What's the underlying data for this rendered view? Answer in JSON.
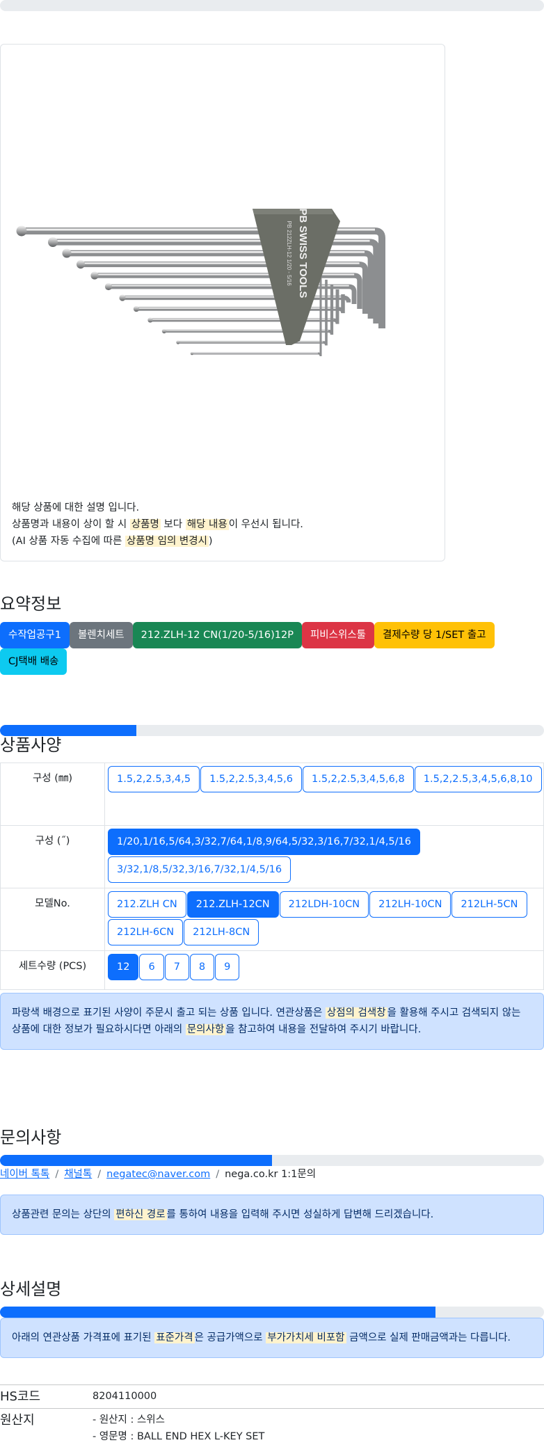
{
  "product": {
    "description_lines": [
      {
        "parts": [
          {
            "t": "해당 상품에 대한 설명 입니다."
          }
        ]
      },
      {
        "parts": [
          {
            "t": "상품명과 내용이 상이 할 시 "
          },
          {
            "t": "상품명",
            "hl": true
          },
          {
            "t": " 보다 "
          },
          {
            "t": "해당 내용",
            "hl": true
          },
          {
            "t": "이 우선시 됩니다."
          }
        ]
      },
      {
        "parts": [
          {
            "t": "(AI 상품 자동 수집에 따른 "
          },
          {
            "t": "상품명 임의 변경시",
            "hl": true
          },
          {
            "t": ")"
          }
        ]
      }
    ],
    "image": {
      "alt": "PB SWISS TOOLS 212.ZLH-12 hex key set",
      "holder_text": "PB SWISS TOOLS",
      "holder_subtext": "PB 212ZLH-12  1/20 - 5/16"
    }
  },
  "summary": {
    "title": "요약정보",
    "badges": [
      {
        "label": "수작업공구1",
        "variant": "primary"
      },
      {
        "label": "볼렌치세트",
        "variant": "secondary"
      },
      {
        "label": "212.ZLH-12 CN(1/20-5/16)12P",
        "variant": "success"
      },
      {
        "label": "피비스위스툴",
        "variant": "danger"
      },
      {
        "label": "결제수량 당 1/SET 출고",
        "variant": "warning"
      },
      {
        "label": "CJ택배 배송",
        "variant": "info"
      }
    ]
  },
  "specs": {
    "title": "상품사양",
    "progress": 0.25,
    "rows": [
      {
        "label": "구성 (㎜)",
        "options": [
          {
            "label": "1.5,2,2.5,3,4,5",
            "active": false
          },
          {
            "label": "1.5,2,2.5,3,4,5,6",
            "active": false
          },
          {
            "label": "1.5,2,2.5,3,4,5,6,8",
            "active": false
          },
          {
            "label": "1.5,2,2.5,3,4,5,6,8,10",
            "active": false
          }
        ]
      },
      {
        "label": "구성 (˝)",
        "options": [
          {
            "label": "1/20,1/16,5/64,3/32,7/64,1/8,9/64,5/32,3/16,7/32,1/4,5/16",
            "active": true
          },
          {
            "label": "3/32,1/8,5/32,3/16,7/32,1/4,5/16",
            "active": false
          }
        ]
      },
      {
        "label": "모델No.",
        "options": [
          {
            "label": "212.ZLH CN",
            "active": false
          },
          {
            "label": "212.ZLH-12CN",
            "active": true
          },
          {
            "label": "212LDH-10CN",
            "active": false
          },
          {
            "label": "212LH-10CN",
            "active": false
          },
          {
            "label": "212LH-5CN",
            "active": false
          },
          {
            "label": "212LH-6CN",
            "active": false
          },
          {
            "label": "212LH-8CN",
            "active": false
          }
        ]
      },
      {
        "label": "세트수량 (PCS)",
        "options": [
          {
            "label": "12",
            "active": true
          },
          {
            "label": "6",
            "active": false
          },
          {
            "label": "7",
            "active": false
          },
          {
            "label": "8",
            "active": false
          },
          {
            "label": "9",
            "active": false
          }
        ]
      }
    ],
    "notice": [
      {
        "t": "파랑색 배경으로 표기된 사양이 주문시 출고 되는 상품 입니다. 연관상품은 "
      },
      {
        "t": "상점의 검색창",
        "hl": true
      },
      {
        "t": "을 활용해 주시고 검색되지 않는 상품에 대한 정보가 필요하시다면 아래의 "
      },
      {
        "t": "문의사항",
        "hl": true
      },
      {
        "t": "을 참고하여 내용을 전달하여 주시기 바랍니다."
      }
    ]
  },
  "inquiry": {
    "title": "문의사항",
    "progress": 0.5,
    "links": [
      {
        "label": "네이버 톡톡",
        "link": true
      },
      {
        "label": "채널톡",
        "link": true
      },
      {
        "label": "negatec@naver.com",
        "link": true
      },
      {
        "label": "nega.co.kr 1:1문의",
        "link": false
      }
    ],
    "separator": "/",
    "notice": [
      {
        "t": "상품관련 문의는 상단의 "
      },
      {
        "t": "편하신 경로",
        "hl": true
      },
      {
        "t": "를 통하여 내용을 입력해 주시면 성실하게 답변해 드리겠습니다."
      }
    ]
  },
  "detail": {
    "title": "상세설명",
    "progress": 0.8,
    "notice": [
      {
        "t": "아래의 연관상품 가격표에 표기된 "
      },
      {
        "t": "표준가격",
        "hl": true
      },
      {
        "t": "은 공급가액으로 "
      },
      {
        "t": "부가가치세 비포함",
        "hl": true
      },
      {
        "t": " 금액으로 실제 판매금액과는 다릅니다."
      }
    ],
    "info_rows": [
      {
        "label": "HS코드",
        "lines": [
          "8204110000"
        ]
      },
      {
        "label": "원산지",
        "lines": [
          "- 원산지 : 스위스",
          "- 영문명 : BALL END HEX L-KEY SET"
        ]
      }
    ]
  },
  "colors": {
    "primary": "#0d6efd",
    "highlight": "#fff3cd",
    "alert_bg": "#cfe2ff",
    "holder": "#6b6e66"
  }
}
